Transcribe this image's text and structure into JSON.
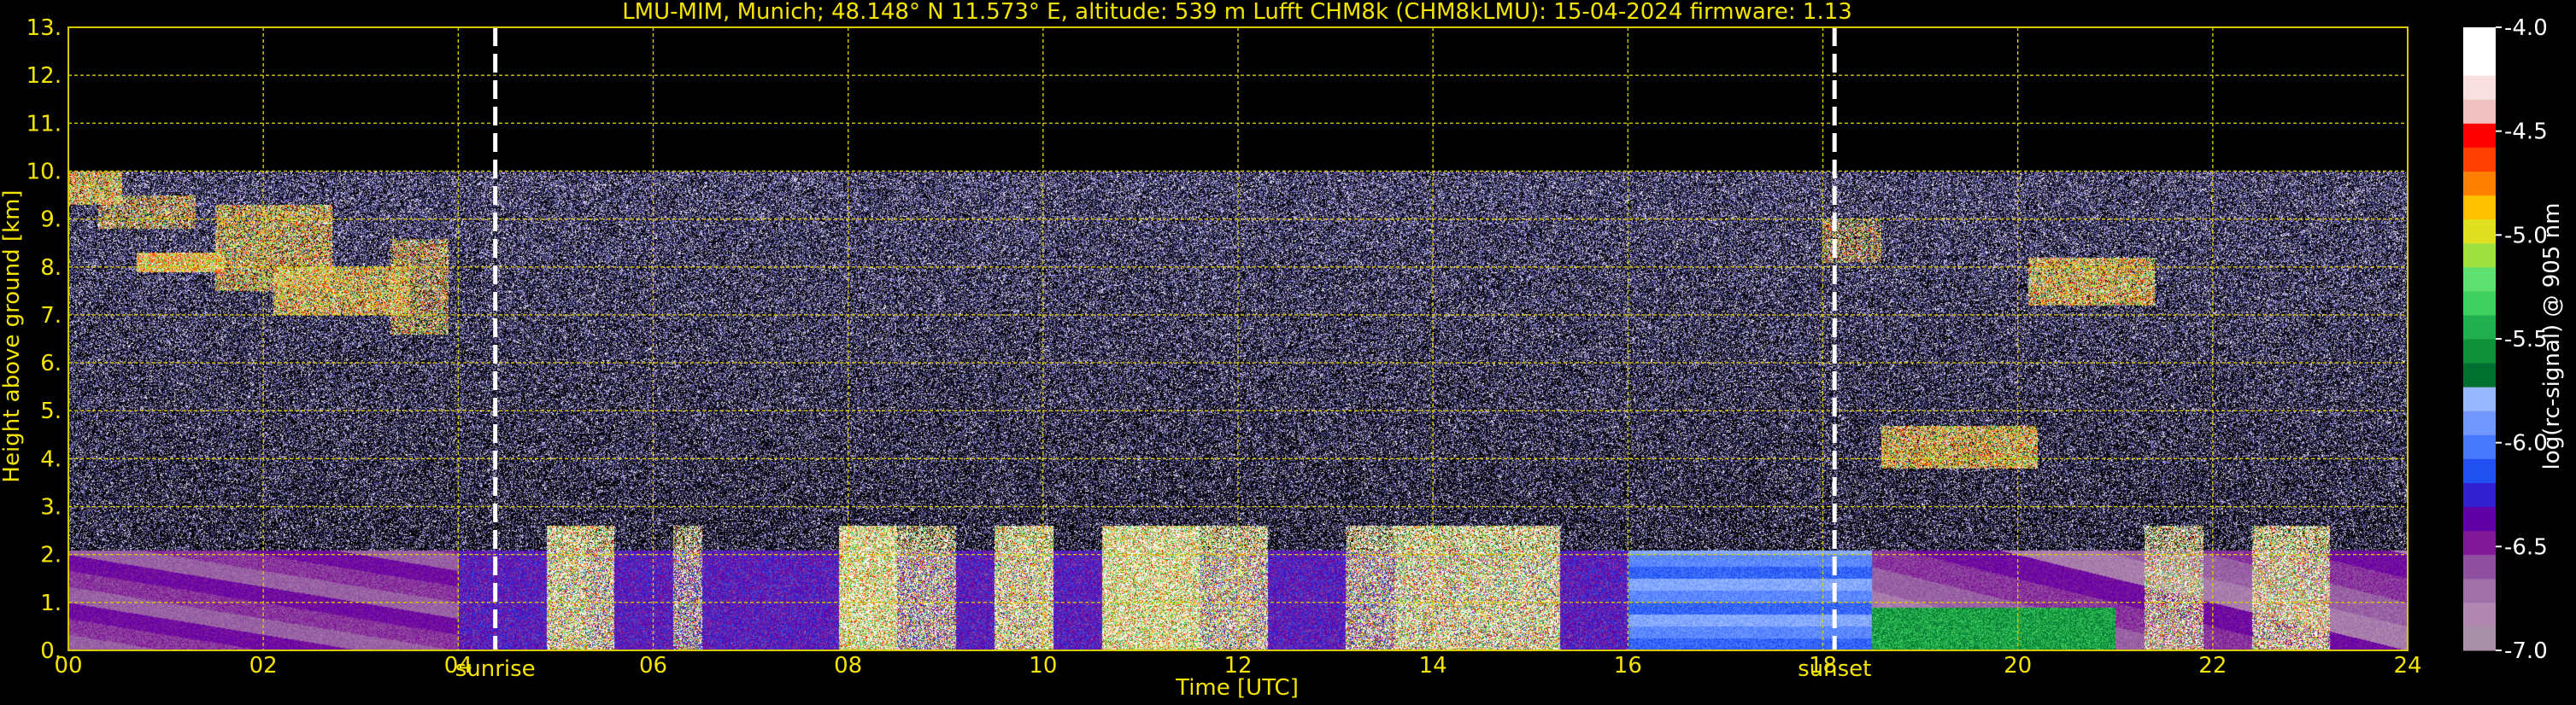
{
  "chart_data": {
    "type": "heatmap",
    "title": "LMU-MIM, Munich; 48.148° N 11.573° E, altitude: 539 m    Lufft CHM8k (CHM8kLMU): 15-04-2024    firmware: 1.13",
    "xlabel": "Time [UTC]",
    "ylabel": "Height above ground [km]",
    "xlim": [
      0,
      24
    ],
    "ylim": [
      0,
      13
    ],
    "x_tick_labels": [
      "00",
      "02",
      "04",
      "06",
      "08",
      "10",
      "12",
      "14",
      "16",
      "18",
      "20",
      "22",
      "24"
    ],
    "x_ticks": [
      0,
      2,
      4,
      6,
      8,
      10,
      12,
      14,
      16,
      18,
      20,
      22,
      24
    ],
    "y_tick_labels": [
      "0.",
      "1.",
      "2.",
      "3.",
      "4.",
      "5.",
      "6.",
      "7.",
      "8.",
      "9.",
      "10.",
      "11.",
      "12.",
      "13."
    ],
    "y_ticks": [
      0,
      1,
      2,
      3,
      4,
      5,
      6,
      7,
      8,
      9,
      10,
      11,
      12,
      13
    ],
    "grid": true,
    "data_top_km": 10,
    "markers": [
      {
        "label": "sunrise",
        "time": 4.38
      },
      {
        "label": "sunset",
        "time": 18.12
      }
    ],
    "colorbar": {
      "label": "log(rc-signal) @ 905 nm",
      "range": [
        -7.0,
        -4.0
      ],
      "tick_labels": [
        "-4.0",
        "-4.5",
        "-5.0",
        "-5.5",
        "-6.0",
        "-6.5",
        "-7.0"
      ],
      "ticks": [
        -4.0,
        -4.5,
        -5.0,
        -5.5,
        -6.0,
        -6.5,
        -7.0
      ],
      "colors": [
        "#a890a8",
        "#b088b0",
        "#a070a8",
        "#9050a0",
        "#801898",
        "#6000a8",
        "#3020d0",
        "#2050f0",
        "#4878ff",
        "#7098ff",
        "#98b8ff",
        "#007030",
        "#109038",
        "#20b050",
        "#40d060",
        "#60e070",
        "#a0e040",
        "#e0e020",
        "#ffc000",
        "#ff8000",
        "#ff4000",
        "#ff0000",
        "#f0c0c0",
        "#f8e0e0",
        "#ffffff",
        "#ffffff"
      ]
    }
  }
}
